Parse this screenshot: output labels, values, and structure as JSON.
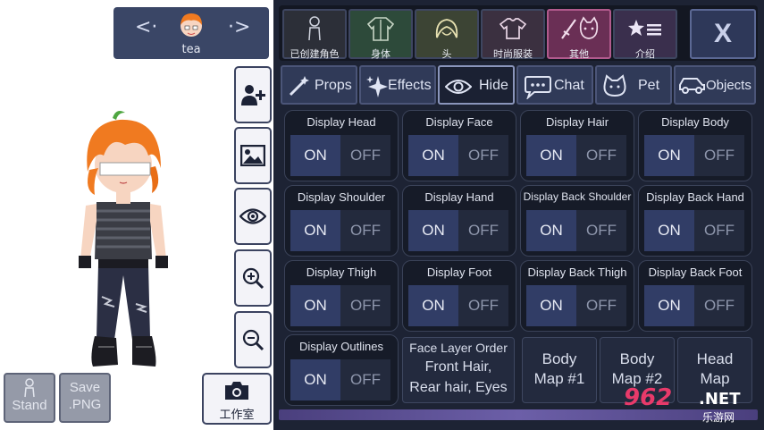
{
  "character": {
    "name": "tea"
  },
  "left_buttons": {
    "stand_label_1": "Stand",
    "save_label_1": "Save",
    "save_label_2": ".PNG",
    "studio_label": "工作室"
  },
  "top_tabs": [
    {
      "label": "已创建角色",
      "icon": "character-silhouette-icon"
    },
    {
      "label": "身体",
      "icon": "jacket-icon"
    },
    {
      "label": "头",
      "icon": "hair-icon"
    },
    {
      "label": "时尚服装",
      "icon": "shirt-icon"
    },
    {
      "label": "其他",
      "icon": "sword-cat-icon"
    },
    {
      "label": "介绍",
      "icon": "star-list-icon"
    }
  ],
  "close_label": "X",
  "sub_tabs": [
    {
      "label": "Props",
      "icon": "wand-icon"
    },
    {
      "label": "Effects",
      "icon": "sparkle-icon"
    },
    {
      "label": "Hide",
      "icon": "eye-icon"
    },
    {
      "label": "Chat",
      "icon": "speech-bubble-icon"
    },
    {
      "label": "Pet",
      "icon": "cat-icon"
    },
    {
      "label": "Objects",
      "icon": "car-icon"
    }
  ],
  "toggles": [
    {
      "title": "Display Head",
      "on": "ON",
      "off": "OFF"
    },
    {
      "title": "Display Face",
      "on": "ON",
      "off": "OFF"
    },
    {
      "title": "Display Hair",
      "on": "ON",
      "off": "OFF"
    },
    {
      "title": "Display Body",
      "on": "ON",
      "off": "OFF"
    },
    {
      "title": "Display Shoulder",
      "on": "ON",
      "off": "OFF"
    },
    {
      "title": "Display Hand",
      "on": "ON",
      "off": "OFF"
    },
    {
      "title": "Display Back Shoulder",
      "on": "ON",
      "off": "OFF"
    },
    {
      "title": "Display Back Hand",
      "on": "ON",
      "off": "OFF"
    },
    {
      "title": "Display Thigh",
      "on": "ON",
      "off": "OFF"
    },
    {
      "title": "Display Foot",
      "on": "ON",
      "off": "OFF"
    },
    {
      "title": "Display Back Thigh",
      "on": "ON",
      "off": "OFF"
    },
    {
      "title": "Display Back Foot",
      "on": "ON",
      "off": "OFF"
    },
    {
      "title": "Display Outlines",
      "on": "ON",
      "off": "OFF"
    }
  ],
  "face_layer": {
    "line1": "Face Layer Order",
    "line2": "Front Hair,",
    "line3": "Rear hair, Eyes"
  },
  "body_map_1": {
    "line1": "Body",
    "line2": "Map #1"
  },
  "body_map_2": {
    "line1": "Body",
    "line2": "Map #2"
  },
  "head_map": {
    "line1": "Head",
    "line2": "Map"
  },
  "watermark": {
    "num": "962",
    "net": ".NET",
    "cn": "乐游网"
  },
  "colors": {
    "panel": "#1d2334",
    "on_active": "#313d66",
    "off": "#232a3d",
    "accent": "#6c5fa8"
  }
}
